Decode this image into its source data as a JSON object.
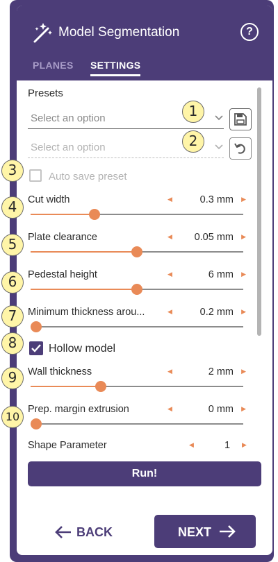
{
  "header": {
    "title": "Model Segmentation",
    "icon": "magic-wand-icon",
    "help_icon": "help-icon",
    "help_glyph": "?",
    "accent_color": "#4c3d78"
  },
  "tabs": [
    {
      "label": "PLANES",
      "active": false
    },
    {
      "label": "SETTINGS",
      "active": true
    }
  ],
  "presets": {
    "label": "Presets",
    "select1_placeholder": "Select an option",
    "select2_placeholder": "Select an option",
    "save_icon": "save-icon",
    "undo_icon": "undo-icon"
  },
  "auto_save": {
    "label": "Auto save preset",
    "checked": false,
    "disabled": true
  },
  "sliders": [
    {
      "label": "Cut width",
      "value": "0.3 mm",
      "fraction": 0.3
    },
    {
      "label": "Plate clearance",
      "value": "0.05 mm",
      "fraction": 0.5
    },
    {
      "label": "Pedestal height",
      "value": "6 mm",
      "fraction": 0.5
    },
    {
      "label": "Minimum thickness arou...",
      "value": "0.2 mm",
      "fraction": 0.0
    },
    {
      "label": "Wall thickness",
      "value": "2 mm",
      "fraction": 0.33
    },
    {
      "label": "Prep. margin extrusion",
      "value": "0 mm",
      "fraction": 0.0
    }
  ],
  "hollow_model": {
    "label": "Hollow model",
    "checked": true
  },
  "shape_parameter": {
    "label": "Shape Parameter",
    "value": "1"
  },
  "run_label": "Run!",
  "nav": {
    "back_label": "BACK",
    "next_label": "NEXT"
  },
  "badges": [
    "1",
    "2",
    "3",
    "4",
    "5",
    "6",
    "7",
    "8",
    "9",
    "10"
  ],
  "colors": {
    "accent": "#4c3d78",
    "slider": "#e98a57",
    "badge": "#fff5a8"
  }
}
